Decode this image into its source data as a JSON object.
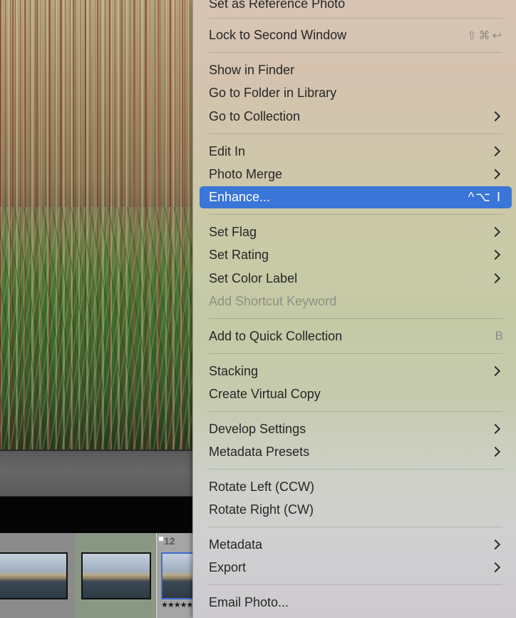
{
  "filmstrip": {
    "selected_number": "12",
    "selected_rating": "★★★★★"
  },
  "menu": {
    "items": {
      "set_reference": "Set as Reference Photo",
      "lock_second": {
        "label": "Lock to Second Window",
        "shortcut_icons": [
          "⇧",
          "⌘",
          "↩"
        ]
      },
      "show_finder": "Show in Finder",
      "go_folder": "Go to Folder in Library",
      "go_collection": "Go to Collection",
      "edit_in": "Edit In",
      "photo_merge": "Photo Merge",
      "enhance": {
        "label": "Enhance...",
        "shortcut": "^⌥ I"
      },
      "set_flag": "Set Flag",
      "set_rating": "Set Rating",
      "set_color_label": "Set Color Label",
      "add_shortcut_keyword": "Add Shortcut Keyword",
      "add_quick_collection": {
        "label": "Add to Quick Collection",
        "shortcut": "B"
      },
      "stacking": "Stacking",
      "create_virtual_copy": "Create Virtual Copy",
      "develop_settings": "Develop Settings",
      "metadata_presets": "Metadata Presets",
      "rotate_left": "Rotate Left (CCW)",
      "rotate_right": "Rotate Right (CW)",
      "metadata": "Metadata",
      "export": "Export",
      "email_photo": "Email Photo..."
    }
  },
  "colors": {
    "highlight": "#3a75d8",
    "disabled_text": "#8f9085",
    "menu_text": "#262626"
  }
}
